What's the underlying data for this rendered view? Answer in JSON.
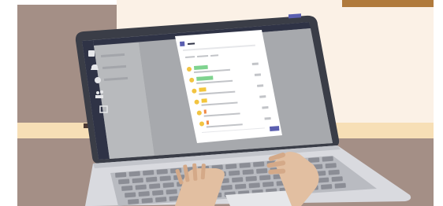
{
  "scene": {
    "description_free": true,
    "colors": {
      "background": "#ffffff",
      "wall_left": "#a48f86",
      "wall_right": "#fbf1e6",
      "shelf": "#f7dfb6",
      "shelf_dark": "#4c3a34",
      "picture_frame": "#b07a3c",
      "laptop_shell": "#3a3d47",
      "laptop_base": "#d9dadf",
      "screen_dark": "#2f3346",
      "screen_gray": "#9fa1a5",
      "screen_gray_light": "#b8babd",
      "dialog_bg": "#ffffff",
      "accent_purple": "#5b5fb0",
      "tag_green": "#7fd38f",
      "tag_yellow": "#f3c63b",
      "tag_orange": "#f08a45",
      "avatar_yellow": "#f2c441",
      "skin": "#e2bfa1",
      "skin_dark": "#d4a988",
      "key": "#8b8d95",
      "key_top": "#a2a4ab"
    },
    "icons": [
      "bell-icon",
      "chat-icon",
      "teams-icon",
      "calendar-icon"
    ],
    "list_rows": [
      {
        "tag_color": "tag_green",
        "tag_fill": 0.35
      },
      {
        "tag_color": "tag_green",
        "tag_fill": 0.42
      },
      {
        "tag_color": "tag_yellow",
        "tag_fill": 0.18
      },
      {
        "tag_color": "tag_yellow",
        "tag_fill": 0.14
      },
      {
        "tag_color": "tag_orange",
        "tag_fill": 0.06
      },
      {
        "tag_color": "tag_orange",
        "tag_fill": 0.03
      }
    ]
  }
}
